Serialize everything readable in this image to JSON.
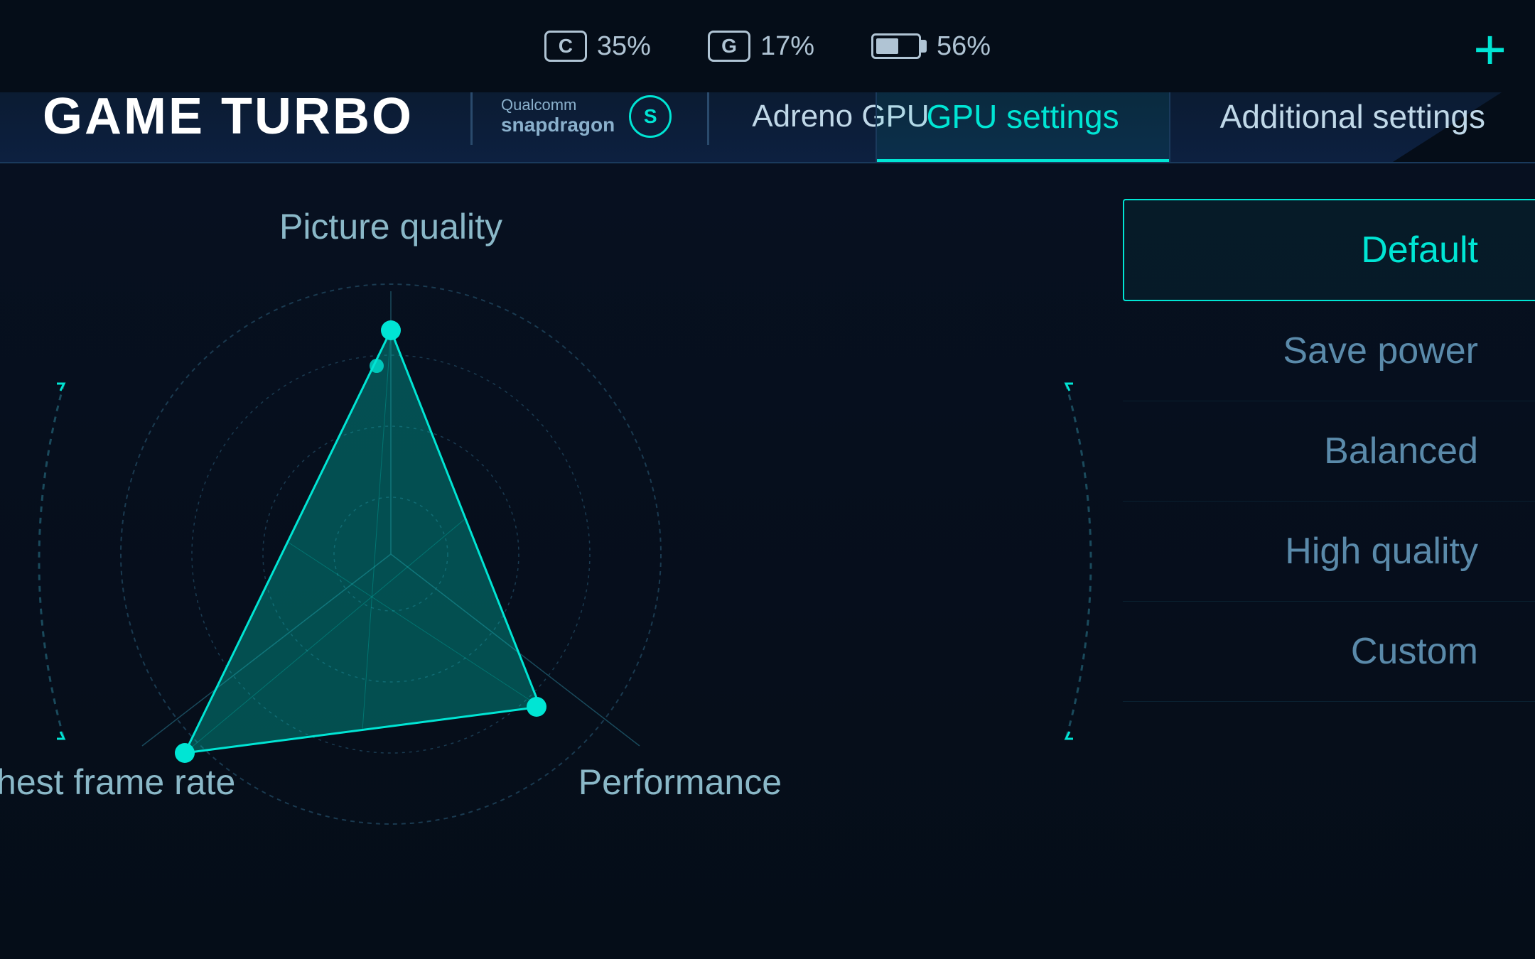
{
  "statusBar": {
    "cpu": {
      "label": "C",
      "value": "35%",
      "icon": "cpu-icon"
    },
    "gpu": {
      "label": "G",
      "value": "17%",
      "icon": "gpu-icon"
    },
    "battery": {
      "value": "56%",
      "icon": "battery-icon"
    },
    "plus": "+"
  },
  "header": {
    "title": "GAME TURBO",
    "brand": "Qualcomm",
    "brandSub": "snapdragon",
    "gpuLabel": "Adreno GPU",
    "tabs": [
      {
        "id": "gpu-settings",
        "label": "GPU settings",
        "active": true
      },
      {
        "id": "additional-settings",
        "label": "Additional settings",
        "active": false
      }
    ]
  },
  "radarChart": {
    "labels": {
      "top": "Picture quality",
      "bottomLeft": "Highest frame rate",
      "bottomRight": "Performance"
    }
  },
  "rightMenu": {
    "items": [
      {
        "id": "default",
        "label": "Default",
        "selected": true
      },
      {
        "id": "save-power",
        "label": "Save power",
        "selected": false
      },
      {
        "id": "balanced",
        "label": "Balanced",
        "selected": false
      },
      {
        "id": "high-quality",
        "label": "High quality",
        "selected": false
      },
      {
        "id": "custom",
        "label": "Custom",
        "selected": false
      }
    ]
  }
}
